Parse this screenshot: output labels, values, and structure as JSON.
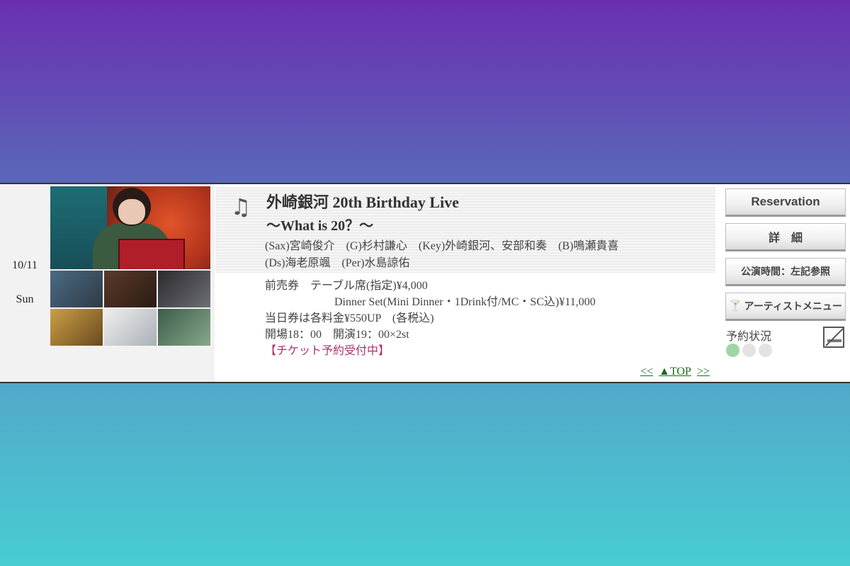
{
  "event": {
    "date": "10/11",
    "weekday": "Sun",
    "icon": "music-note-icon",
    "title": "外崎銀河 20th Birthday Live",
    "subtitle": "〜What is 20？〜",
    "members": [
      "(Sax)宮崎俊介　(G)杉村謙心　(Key)外崎銀河、安部和奏　(B)鳴瀬貴喜",
      "(Ds)海老原颯　(Per)水島諒佑"
    ],
    "prices": {
      "advance": "前売券　テーブル席(指定)¥4,000",
      "dinner_set": "Dinner Set(Mini Dinner・1Drink付/MC・SC込)¥11,000",
      "door": "当日券は各料金¥550UP　(各税込)",
      "times": "開場18：00　開演19：00×2st",
      "ticket_status": "【チケット予約受付中】"
    }
  },
  "nav": {
    "prev": "<<",
    "top": "▲TOP",
    "next": ">>"
  },
  "buttons": {
    "reservation": "Reservation",
    "details": "詳　細",
    "show_time": "公演時間：左記参照",
    "artist_menu": "アーティストメニュー"
  },
  "reservation_status": {
    "label": "予約状況",
    "levels_total": 3,
    "levels_active": 1,
    "active_color": "#9fd6a6",
    "inactive_color": "#e3e3e3",
    "no_smoking_icon": "no-smoking-icon"
  }
}
